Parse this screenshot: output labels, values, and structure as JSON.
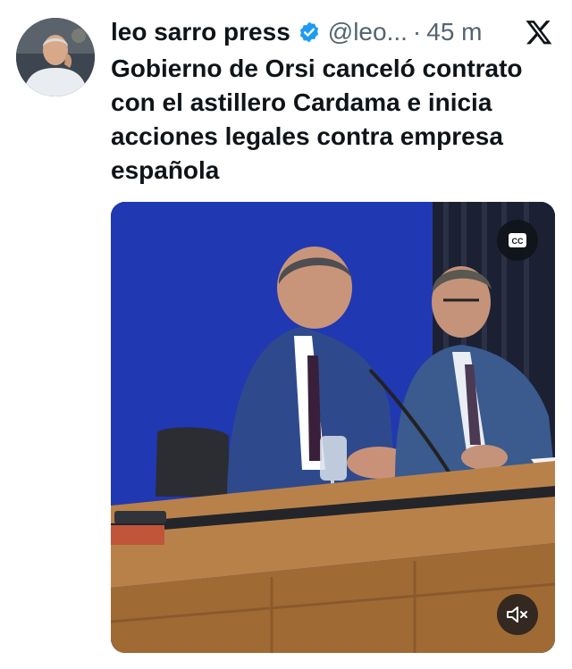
{
  "author": {
    "name": "leo sarro press",
    "handle": "@leo...",
    "separator": "·",
    "time": "45 m",
    "avatar_icon": "avatar-photo",
    "verified_icon": "verified-badge-icon"
  },
  "platform_icon": "x-logo-icon",
  "tweet": {
    "text": "Gobierno de Orsi canceló contrato con el astillero Cardama e inicia acciones legales contra empresa española"
  },
  "media": {
    "type": "video",
    "cc_icon": "cc-icon",
    "cc_label": "CC",
    "mute_icon": "mute-icon"
  },
  "colors": {
    "verified": "#1d9bf0",
    "text_primary": "#0f1419",
    "text_secondary": "#536471",
    "backdrop_blue": "#1a2f9a"
  }
}
